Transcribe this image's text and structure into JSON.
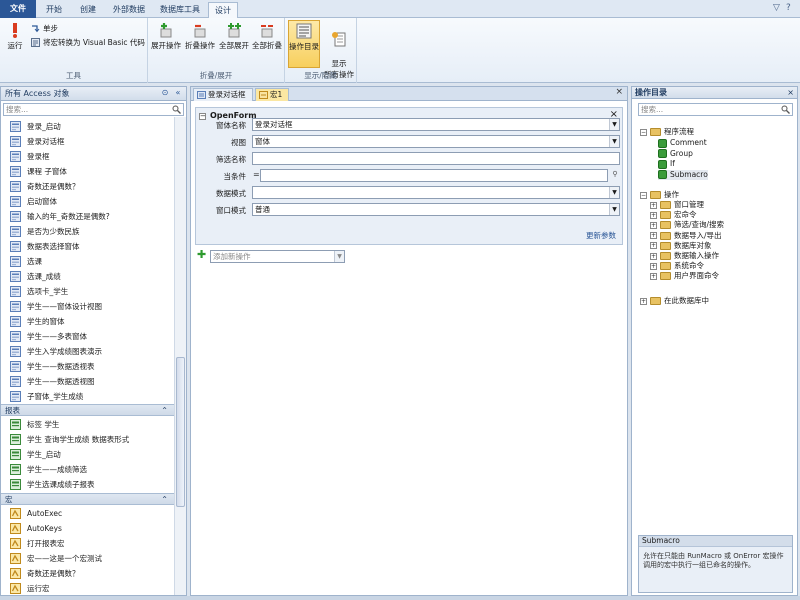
{
  "ribbon": {
    "tabs": [
      "文件",
      "开始",
      "创建",
      "外部数据",
      "数据库工具",
      "设计"
    ],
    "active_tab": "设计",
    "groups": {
      "tools": {
        "label": "工具",
        "run": "运行",
        "step": "单步",
        "convert": "将宏转换为 Visual Basic 代码"
      },
      "collapse": {
        "label": "折叠/展开",
        "expand_action": "展开操作",
        "collapse_action": "折叠操作",
        "expand_all": "全部展开",
        "collapse_all": "全部折叠"
      },
      "show": {
        "label": "显示/隐藏",
        "catalog": "操作目录",
        "show_all": "显示\n所有操作"
      }
    }
  },
  "nav": {
    "title": "所有 Access 对象",
    "search_placeholder": "搜索...",
    "forms": [
      "登录_启动",
      "登录对话框",
      "登录框",
      "课程 子窗体",
      "奇数还是偶数？",
      "启动窗体",
      "输入的年_奇数还是偶数?",
      "是否为少数民族",
      "数据表选择窗体",
      "选课",
      "选课_成绩",
      "选项卡_学生",
      "学生——窗体设计视图",
      "学生的窗体",
      "学生——多表窗体",
      "学生入学成绩图表演示",
      "学生——数据透视表",
      "学生——数据透视图",
      "子窗体_学生成绩"
    ],
    "reports_label": "报表",
    "reports": [
      "标签 学生",
      "学生 查询学生成绩 数据表形式",
      "学生_启动",
      "学生——成绩筛选",
      "学生选课成绩子报表"
    ],
    "macros_label": "宏",
    "macros": [
      "AutoExec",
      "AutoKeys",
      "打开报表宏",
      "宏——这是一个宏测试",
      "奇数还是偶数？",
      "运行宏"
    ]
  },
  "doc": {
    "tabs": [
      "登录对话框",
      "宏1"
    ],
    "action": {
      "name": "OpenForm",
      "args": [
        {
          "label": "窗体名称",
          "value": "登录对话框",
          "has_dropdown": true
        },
        {
          "label": "视图",
          "value": "窗体",
          "has_dropdown": true
        },
        {
          "label": "筛选名称",
          "value": "",
          "has_dropdown": false
        },
        {
          "label": "当条件",
          "value": "",
          "has_dropdown": false
        },
        {
          "label": "数据模式",
          "value": "",
          "has_dropdown": true
        },
        {
          "label": "窗口模式",
          "value": "普通",
          "has_dropdown": true
        }
      ],
      "update_link": "更新参数"
    },
    "add_action_placeholder": "添加新操作"
  },
  "catalog": {
    "title": "操作目录",
    "search_placeholder": "搜索...",
    "flow_label": "程序流程",
    "flow_items": [
      "Comment",
      "Group",
      "If",
      "Submacro"
    ],
    "actions_label": "操作",
    "action_folders": [
      "窗口管理",
      "宏命令",
      "筛选/查询/搜索",
      "数据导入/导出",
      "数据库对象",
      "数据输入操作",
      "系统命令",
      "用户界面命令"
    ],
    "in_db_label": "在此数据库中",
    "desc_title": "Submacro",
    "desc_text": "允许在只能由 RunMacro 或 OnError 宏操作调用的宏中执行一组已命名的操作。"
  },
  "colors": {
    "file_tab": "#2b5797",
    "pressed": "#f7cf5d",
    "form_icon": "#5b7fb8",
    "report_icon": "#3b8a3b",
    "macro_icon": "#d9a534"
  }
}
